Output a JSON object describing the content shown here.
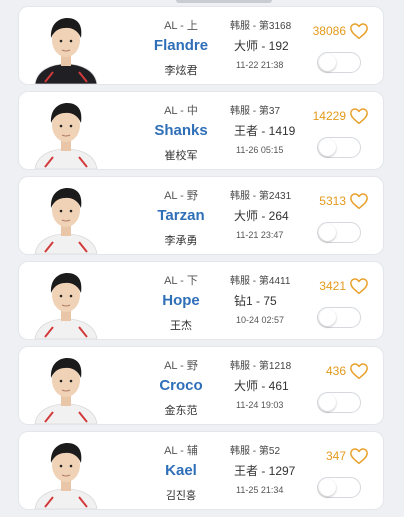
{
  "players": [
    {
      "team_role": "AL - 上",
      "name": "Flandre",
      "realname": "李炫君",
      "server": "韩服 - 第3168",
      "tier": "大师 - 192",
      "time": "11-22 21:38",
      "likes": "38086",
      "avatar_shirt": "#1f1f24",
      "toggle_on": false
    },
    {
      "team_role": "AL - 中",
      "name": "Shanks",
      "realname": "崔校军",
      "server": "韩服 - 第37",
      "tier": "王者 - 1419",
      "time": "11-26 05:15",
      "likes": "14229",
      "avatar_shirt": "#f1f1f1",
      "toggle_on": false
    },
    {
      "team_role": "AL - 野",
      "name": "Tarzan",
      "realname": "李承勇",
      "server": "韩服 - 第2431",
      "tier": "大师 - 264",
      "time": "11-21 23:47",
      "likes": "5313",
      "avatar_shirt": "#f1f1f1",
      "toggle_on": false
    },
    {
      "team_role": "AL - 下",
      "name": "Hope",
      "realname": "王杰",
      "server": "韩服 - 第4411",
      "tier": "钻1 - 75",
      "time": "10-24 02:57",
      "likes": "3421",
      "avatar_shirt": "#f1f1f1",
      "toggle_on": false
    },
    {
      "team_role": "AL - 野",
      "name": "Croco",
      "realname": "金东范",
      "server": "韩服 - 第1218",
      "tier": "大师 - 461",
      "time": "11-24 19:03",
      "likes": "436",
      "avatar_shirt": "#f1f1f1",
      "toggle_on": false
    },
    {
      "team_role": "AL - 辅",
      "name": "Kael",
      "realname": "김진홍",
      "server": "韩服 - 第52",
      "tier": "王者 - 1297",
      "time": "11-25 21:34",
      "likes": "347",
      "avatar_shirt": "#f1f1f1",
      "toggle_on": false
    }
  ],
  "colors": {
    "accent_name": "#2f6fb8",
    "like_count": "#e39a1c",
    "heart": "#e8a02a"
  },
  "icons": {
    "like": "heart-icon",
    "toggle": "toggle-switch"
  }
}
